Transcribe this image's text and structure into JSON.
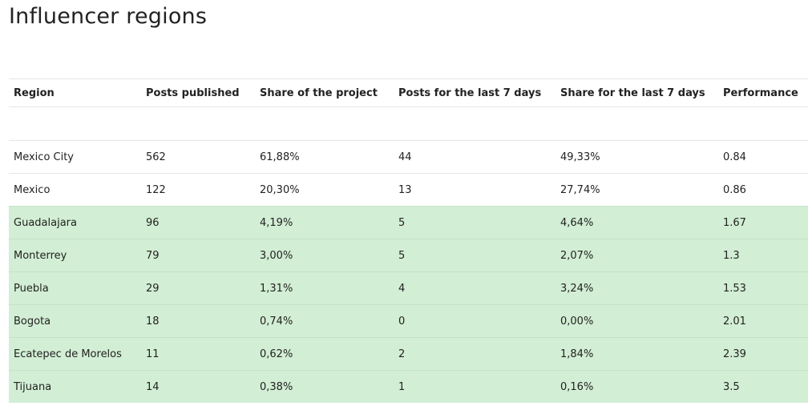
{
  "title": "Influencer regions",
  "table": {
    "columns": [
      "Region",
      "Posts published",
      "Share of the project",
      "Posts for the last 7 days",
      "Share for the last 7 days",
      "Performance"
    ],
    "rows": [
      [
        "Mexico City",
        "562",
        "61,88%",
        "44",
        "49,33%",
        "0.84"
      ],
      [
        "Mexico",
        "122",
        "20,30%",
        "13",
        "27,74%",
        "0.86"
      ],
      [
        "Guadalajara",
        "96",
        "4,19%",
        "5",
        "4,64%",
        "1.67"
      ],
      [
        "Monterrey",
        "79",
        "3,00%",
        "5",
        "2,07%",
        "1.3"
      ],
      [
        "Puebla",
        "29",
        "1,31%",
        "4",
        "3,24%",
        "1.53"
      ],
      [
        "Bogota",
        "18",
        "0,74%",
        "0",
        "0,00%",
        "2.01"
      ],
      [
        "Ecatepec de Morelos",
        "11",
        "0,62%",
        "2",
        "1,84%",
        "2.39"
      ],
      [
        "Tijuana",
        "14",
        "0,38%",
        "1",
        "0,16%",
        "3.5"
      ]
    ],
    "highlighted_rows": [
      2,
      3,
      4,
      5,
      6,
      7
    ]
  },
  "colors": {
    "highlight": "#d2eed4",
    "border": "#e3e6e8",
    "text": "#222222"
  }
}
